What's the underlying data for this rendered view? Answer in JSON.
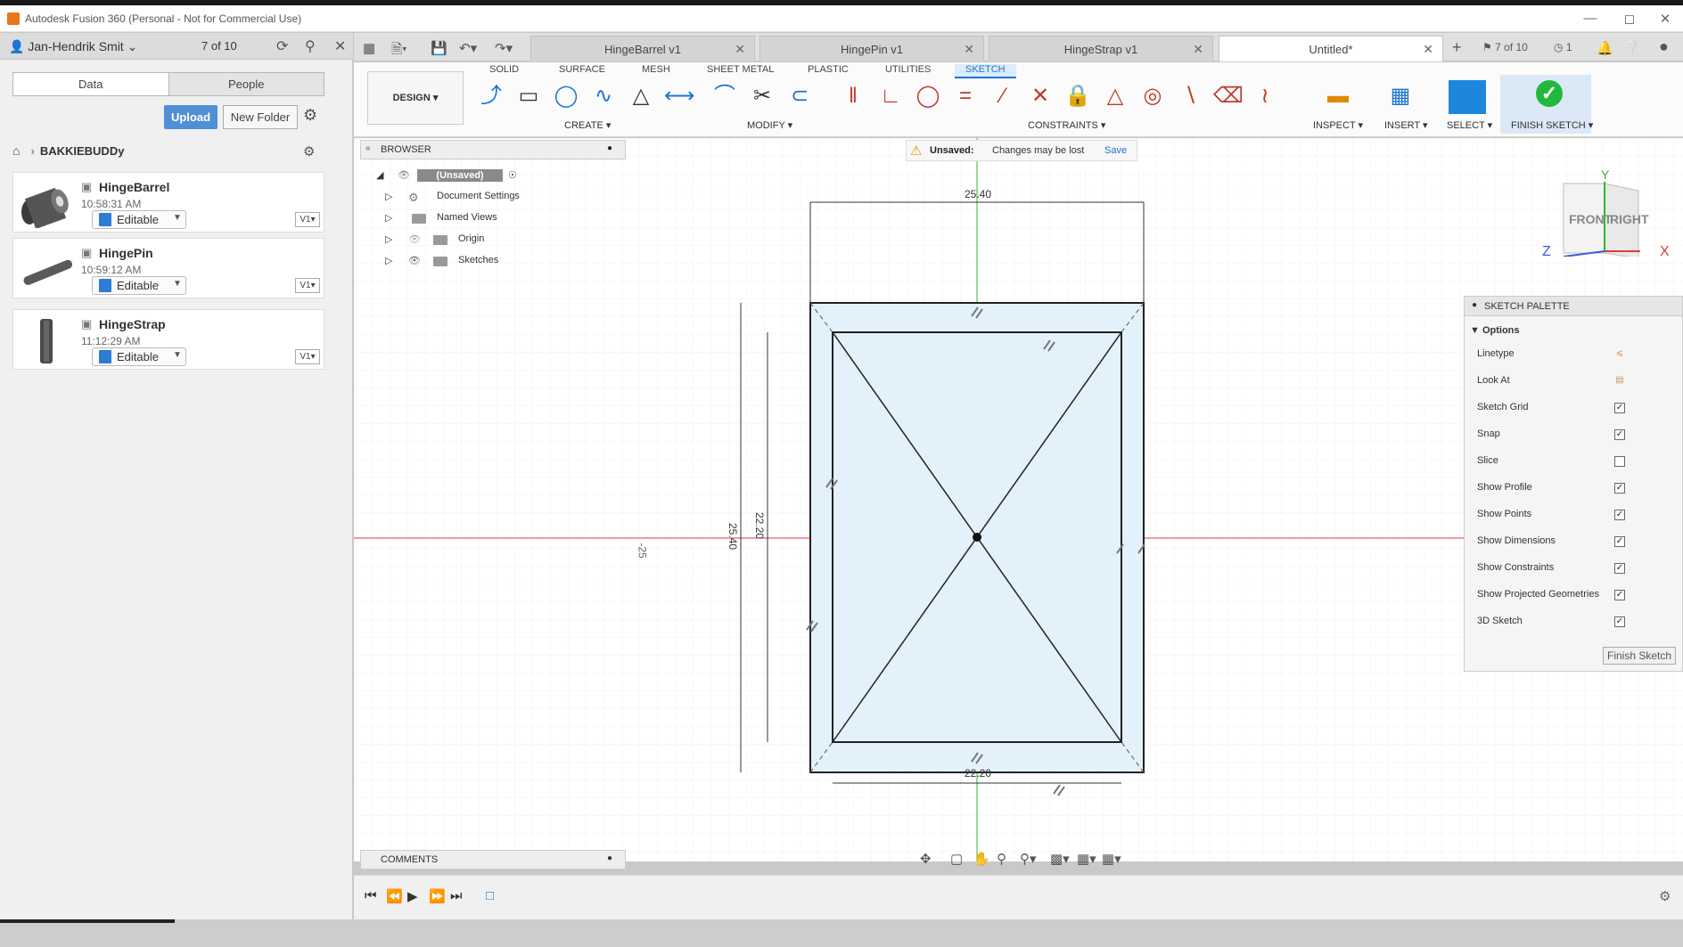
{
  "window": {
    "title": "Autodesk Fusion 360 (Personal - Not for Commercial Use)"
  },
  "user": {
    "name": "Jan-Hendrik Smit",
    "count": "7 of 10"
  },
  "data_panel": {
    "tabs": [
      "Data",
      "People"
    ],
    "upload_label": "Upload",
    "new_folder_label": "New Folder",
    "breadcrumb": "BAKKIEBUDDy",
    "files": [
      {
        "name": "HingeBarrel",
        "time": "10:58:31 AM",
        "status": "Editable",
        "version": "V1"
      },
      {
        "name": "HingePin",
        "time": "10:59:12 AM",
        "status": "Editable",
        "version": "V1"
      },
      {
        "name": "HingeStrap",
        "time": "11:12:29 AM",
        "status": "Editable",
        "version": "V1"
      }
    ]
  },
  "doc_tabs": [
    "HingeBarrel v1",
    "HingePin v1",
    "HingeStrap v1",
    "Untitled*"
  ],
  "doc_count": "7 of 10",
  "jobs_count": "1",
  "toolbar": {
    "workspace": "DESIGN",
    "tabs": [
      "SOLID",
      "SURFACE",
      "MESH",
      "SHEET METAL",
      "PLASTIC",
      "UTILITIES",
      "SKETCH"
    ],
    "groups": {
      "create": "CREATE",
      "modify": "MODIFY",
      "constraints": "CONSTRAINTS",
      "inspect": "INSPECT",
      "insert": "INSERT",
      "select": "SELECT",
      "finish": "FINISH SKETCH"
    }
  },
  "browser": {
    "title": "BROWSER",
    "root": "(Unsaved)",
    "items": [
      "Document Settings",
      "Named Views",
      "Origin",
      "Sketches"
    ]
  },
  "notice": {
    "label": "Unsaved:",
    "message": "Changes may be lost",
    "action": "Save"
  },
  "sketch": {
    "dim_outer": "25.40",
    "dim_inner": "22.20",
    "axis_label": "-25"
  },
  "viewcube": {
    "front": "FRONT",
    "right": "RIGHT",
    "x": "X",
    "y": "Y",
    "z": "Z"
  },
  "palette": {
    "title": "SKETCH PALETTE",
    "section": "Options",
    "rows": [
      {
        "label": "Linetype",
        "checked": null
      },
      {
        "label": "Look At",
        "checked": null
      },
      {
        "label": "Sketch Grid",
        "checked": true
      },
      {
        "label": "Snap",
        "checked": true
      },
      {
        "label": "Slice",
        "checked": false
      },
      {
        "label": "Show Profile",
        "checked": true
      },
      {
        "label": "Show Points",
        "checked": true
      },
      {
        "label": "Show Dimensions",
        "checked": true
      },
      {
        "label": "Show Constraints",
        "checked": true
      },
      {
        "label": "Show Projected Geometries",
        "checked": true
      },
      {
        "label": "3D Sketch",
        "checked": true
      }
    ],
    "finish_label": "Finish Sketch"
  },
  "comments": {
    "title": "COMMENTS"
  },
  "colors": {
    "accent": "#1976d2",
    "finish_green": "#22b83b",
    "axis_red": "#e23a3a",
    "axis_green": "#2eb82e",
    "profile_fill": "#e3f1fb"
  }
}
